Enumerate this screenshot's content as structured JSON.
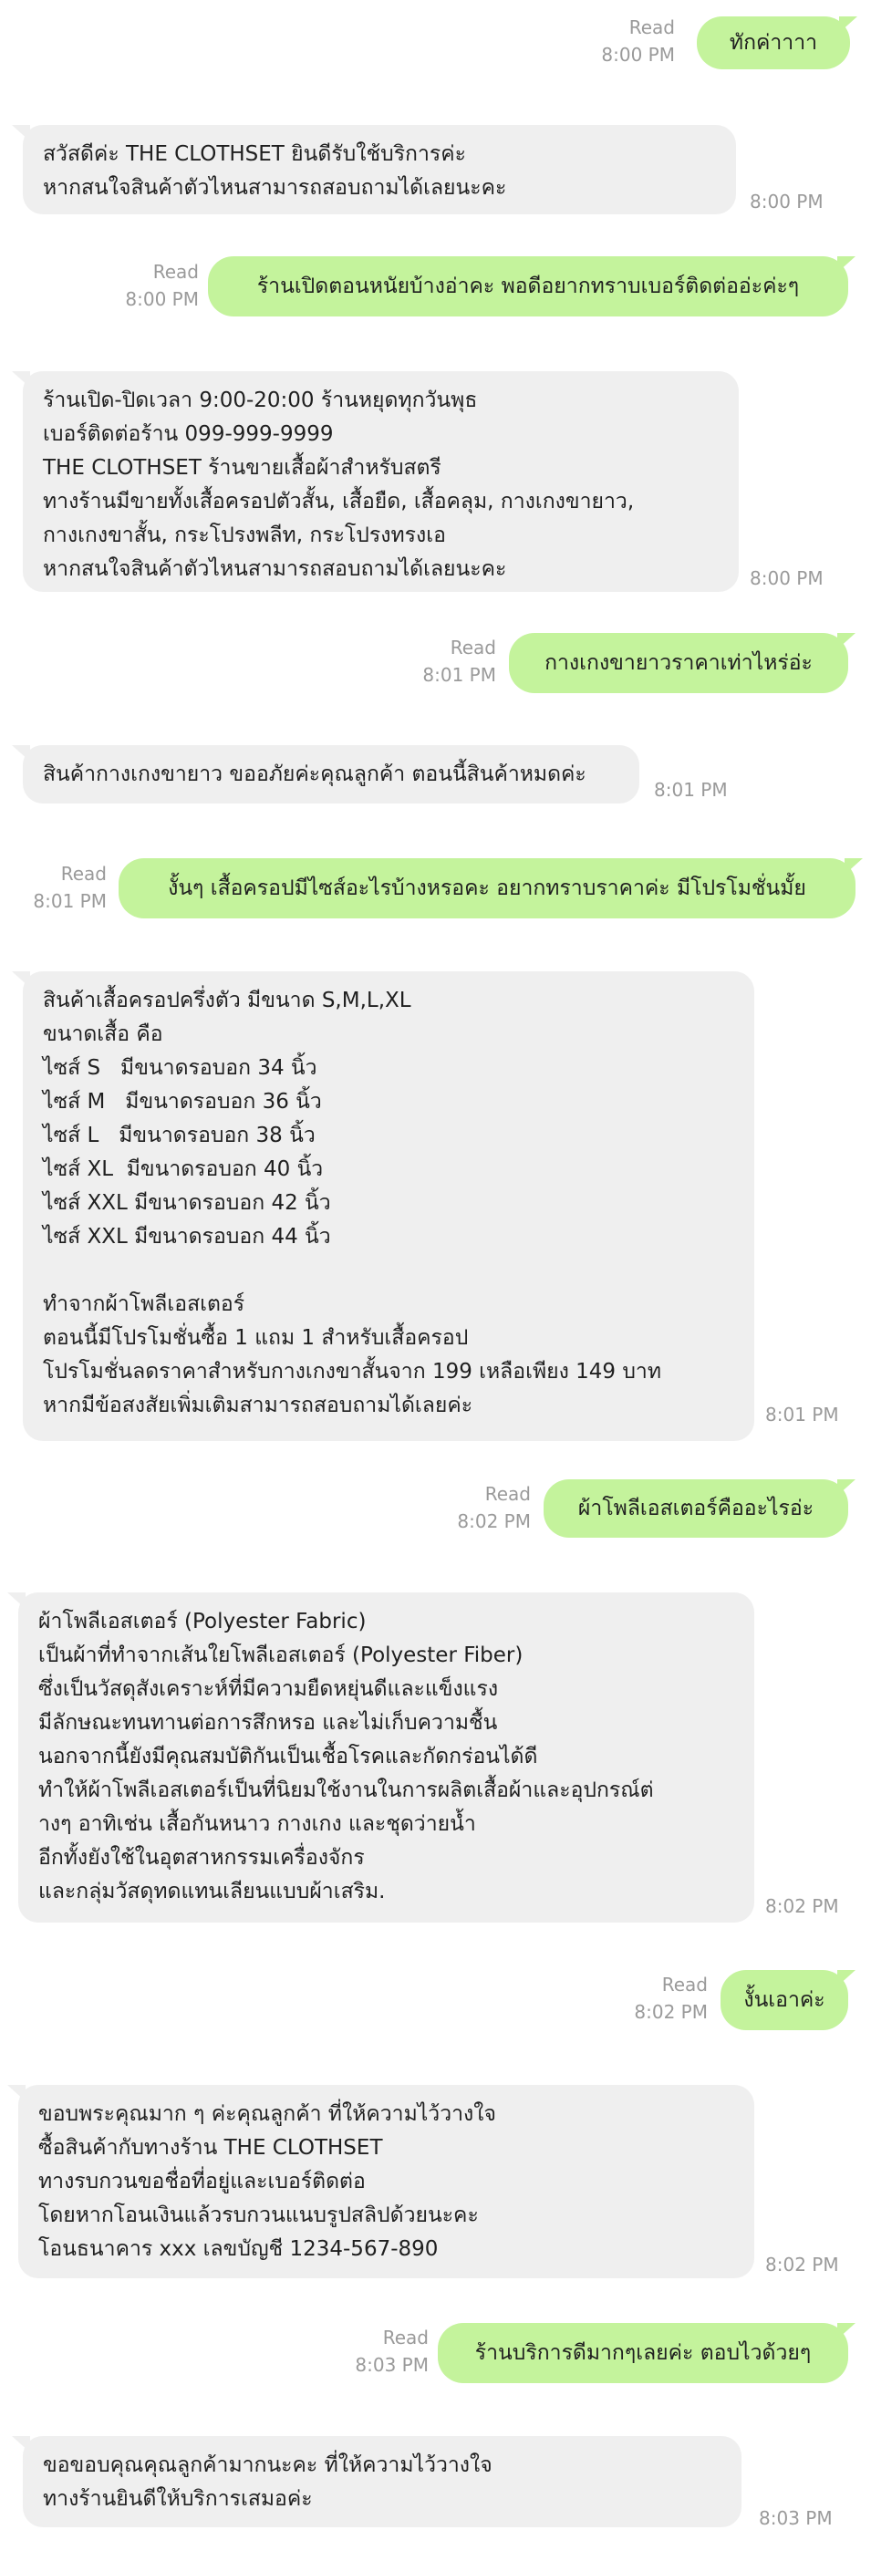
{
  "colors": {
    "outgoing_bubble": "#c4f39c",
    "incoming_bubble": "#efefef",
    "meta_text": "#9a9a9a"
  },
  "messages": [
    {
      "dir": "out",
      "text": "ทักค่าาาา",
      "status": "Read",
      "time": "8:00 PM"
    },
    {
      "dir": "in",
      "text": "สวัสดีค่ะ THE CLOTHSET ยินดีรับใช้บริการค่ะ\nหากสนใจสินค้าตัวไหนสามารถสอบถามได้เลยนะคะ",
      "time": "8:00 PM"
    },
    {
      "dir": "out",
      "text": "ร้านเปิดตอนหนัยบ้างอ่าคะ พอดีอยากทราบเบอร์ติดต่ออ่ะค่ะๆ",
      "status": "Read",
      "time": "8:00 PM"
    },
    {
      "dir": "in",
      "text": "ร้านเปิด-ปิดเวลา 9:00-20:00 ร้านหยุดทุกวันพุธ\nเบอร์ติดต่อร้าน 099-999-9999\nTHE CLOTHSET ร้านขายเสื้อผ้าสำหรับสตรี\nทางร้านมีขายทั้งเสื้อครอปตัวสั้น, เสื้อยืด, เสื้อคลุม, กางเกงขายาว,\nกางเกงขาสั้น, กระโปรงพลีท, กระโปรงทรงเอ\nหากสนใจสินค้าตัวไหนสามารถสอบถามได้เลยนะคะ",
      "time": "8:00 PM"
    },
    {
      "dir": "out",
      "text": "กางเกงขายาวราคาเท่าไหร่อ่ะ",
      "status": "Read",
      "time": "8:01 PM"
    },
    {
      "dir": "in",
      "text": "สินค้ากางเกงขายาว ขออภัยค่ะคุณลูกค้า ตอนนี้สินค้าหมดค่ะ",
      "time": "8:01 PM"
    },
    {
      "dir": "out",
      "text": "งั้นๆ เสื้อครอปมีไซส์อะไรบ้างหรอคะ อยากทราบราคาค่ะ มีโปรโมชั่นมั้ย",
      "status": "Read",
      "time": "8:01 PM"
    },
    {
      "dir": "in",
      "text": "สินค้าเสื้อครอปครึ่งตัว มีขนาด S,M,L,XL\nขนาดเสื้อ คือ\nไซส์ S   มีขนาดรอบอก 34 นิ้ว\nไซส์ M   มีขนาดรอบอก 36 นิ้ว\nไซส์ L   มีขนาดรอบอก 38 นิ้ว\nไซส์ XL  มีขนาดรอบอก 40 นิ้ว\nไซส์ XXL มีขนาดรอบอก 42 นิ้ว\nไซส์ XXL มีขนาดรอบอก 44 นิ้ว\n\nทำจากผ้าโพลีเอสเตอร์\nตอนนี้มีโปรโมชั่นซื้อ 1 แถม 1 สำหรับเสื้อครอป\nโปรโมชั่นลดราคาสำหรับกางเกงขาสั้นจาก 199 เหลือเพียง 149 บาท\nหากมีข้อสงสัยเพิ่มเติมสามารถสอบถามได้เลยค่ะ",
      "time": "8:01 PM"
    },
    {
      "dir": "out",
      "text": "ผ้าโพลีเอสเตอร์คืออะไรอ่ะ",
      "status": "Read",
      "time": "8:02 PM"
    },
    {
      "dir": "in",
      "text": "ผ้าโพลีเอสเตอร์ (Polyester Fabric)\nเป็นผ้าที่ทำจากเส้นใยโพลีเอสเตอร์ (Polyester Fiber)\nซึ่งเป็นวัสดุสังเคราะห์ที่มีความยืดหยุ่นดีและแข็งแรง\nมีลักษณะทนทานต่อการสึกหรอ และไม่เก็บความชื้น\nนอกจากนี้ยังมีคุณสมบัติกันเป็นเชื้อโรคและกัดกร่อนได้ดี\nทำให้ผ้าโพลีเอสเตอร์เป็นที่นิยมใช้งานในการผลิตเสื้อผ้าและอุปกรณ์ต่\nางๆ อาทิเช่น เสื้อกันหนาว กางเกง และชุดว่ายน้ำ\nอีกทั้งยังใช้ในอุตสาหกรรมเครื่องจักร\nและกลุ่มวัสดุทดแทนเลียนแบบผ้าเสริม.",
      "time": "8:02 PM"
    },
    {
      "dir": "out",
      "text": "งั้นเอาค่ะ",
      "status": "Read",
      "time": "8:02 PM"
    },
    {
      "dir": "in",
      "text": "ขอบพระคุณมาก ๆ ค่ะคุณลูกค้า ที่ให้ความไว้วางใจ\nซื้อสินค้ากับทางร้าน THE CLOTHSET\nทางรบกวนขอชื่อที่อยู่และเบอร์ติดต่อ\nโดยหากโอนเงินแล้วรบกวนแนบรูปสลิปด้วยนะคะ\nโอนธนาคาร xxx เลขบัญชี 1234-567-890",
      "time": "8:02 PM"
    },
    {
      "dir": "out",
      "text": "ร้านบริการดีมากๆเลยค่ะ ตอบไวด้วยๆ",
      "status": "Read",
      "time": "8:03 PM"
    },
    {
      "dir": "in",
      "text": "ขอขอบคุณคุณลูกค้ามากนะคะ ที่ให้ความไว้วางใจ\nทางร้านยินดีให้บริการเสมอค่ะ",
      "time": "8:03 PM"
    }
  ]
}
